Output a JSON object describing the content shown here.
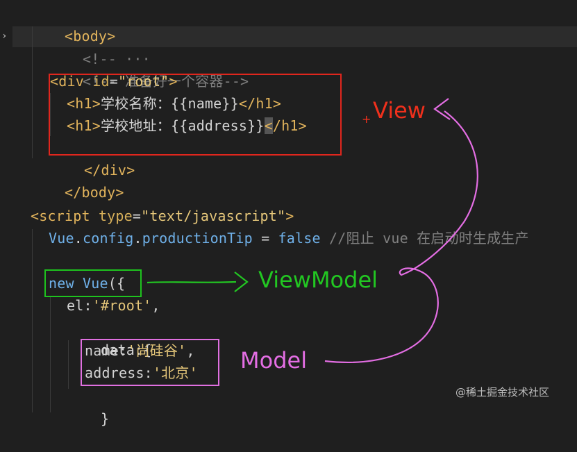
{
  "code": {
    "l1_body_open": "<body>",
    "l2_folded_comment": "<!-- ···",
    "l3_comment": "<!-- 准备好一个容器-->",
    "l4_div_open_a": "<div ",
    "l4_div_attr": "id",
    "l4_div_eq": "=",
    "l4_div_val": "\"root\"",
    "l4_div_close": ">",
    "l5_h1_open": "<h1>",
    "l5_text": "学校名称：{{name}}",
    "l5_h1_close": "</h1>",
    "l6_h1_open": "<h1>",
    "l6_text": "学校地址：{{address}}",
    "l6_h1_close_lt": "<",
    "l6_h1_close_rest": "/h1>",
    "l7_div_close": "</div>",
    "l8_body_close": "</body>",
    "l9_script_open": "<script ",
    "l9_attr": "type",
    "l9_eq": "=",
    "l9_val": "\"text/javascript\"",
    "l9_close": ">",
    "l10_vue": "Vue",
    "l10_dot1": ".",
    "l10_config": "config",
    "l10_dot2": ".",
    "l10_prop": "productionTip",
    "l10_eq": " = ",
    "l10_false": "false",
    "l10_comment": " //阻止 vue 在启动时生成生产",
    "l11_new": "new ",
    "l11_vue": "Vue",
    "l11_rest": "({",
    "l12_el": "el:",
    "l12_val": "'#root'",
    "l12_comma": ",",
    "l13_data": "data:{",
    "l14_name": "name:",
    "l14_val": "'尚硅谷'",
    "l14_comma": ",",
    "l15_address": "address:",
    "l15_val": "'北京'",
    "l16_close": "}"
  },
  "annotations": {
    "view": "View",
    "viewmodel": "ViewModel",
    "model": "Model"
  },
  "watermark": "@稀土掘金技术社区",
  "colors": {
    "view": "#f0301c",
    "viewmodel": "#22c722",
    "model": "#e46ee4"
  }
}
